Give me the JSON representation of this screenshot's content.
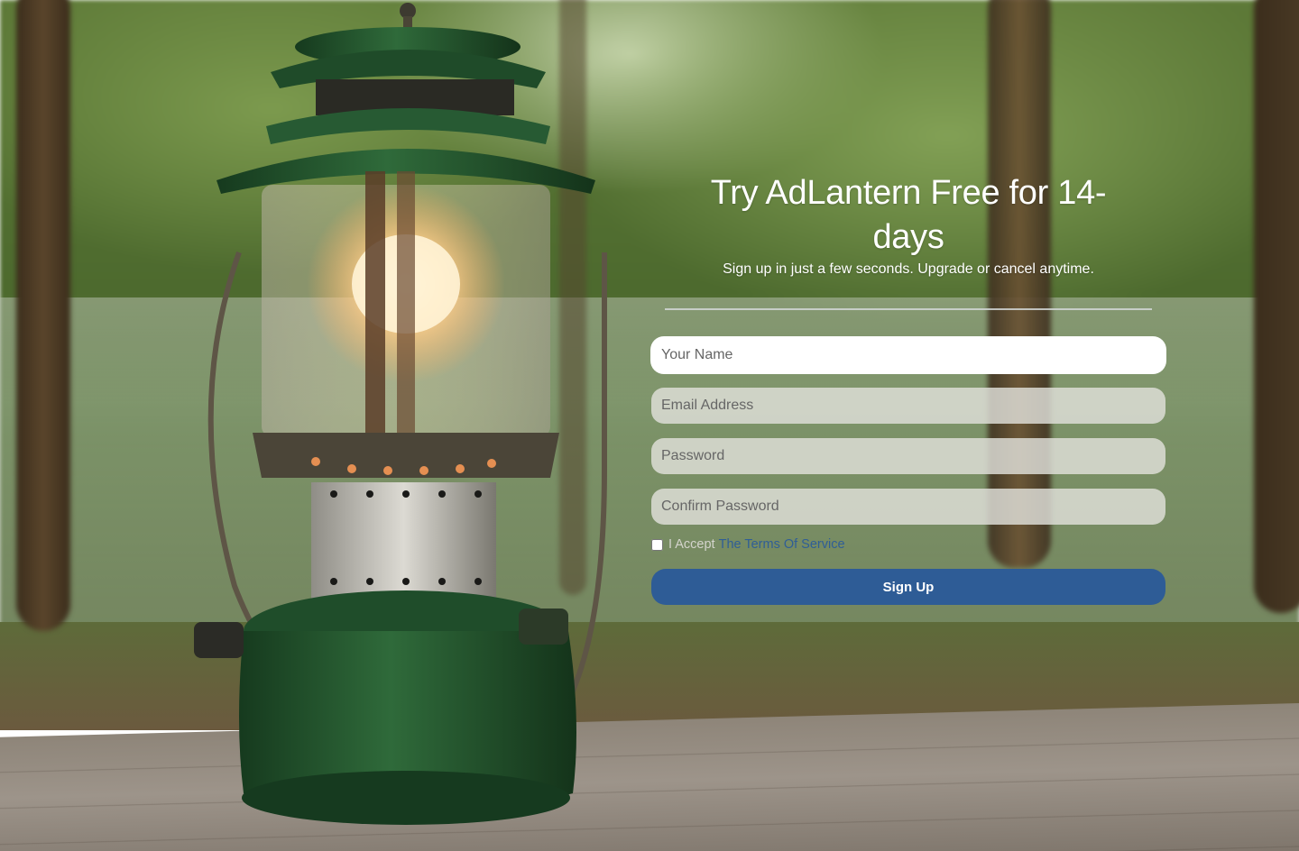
{
  "hero": {
    "title": "Try AdLantern Free for 14-days",
    "subtitle": "Sign up in just a few seconds. Upgrade or cancel anytime."
  },
  "form": {
    "name_placeholder": "Your Name",
    "email_placeholder": "Email Address",
    "password_placeholder": "Password",
    "confirm_placeholder": "Confirm Password",
    "terms_prefix": "I Accept",
    "terms_link": "The Terms Of Service",
    "terms_checked": false,
    "submit_label": "Sign Up"
  },
  "colors": {
    "primary": "#2e5c96",
    "link": "#2f5e96",
    "text_on_image": "#ffffff"
  },
  "background": {
    "subject": "camping-lantern-on-table"
  }
}
